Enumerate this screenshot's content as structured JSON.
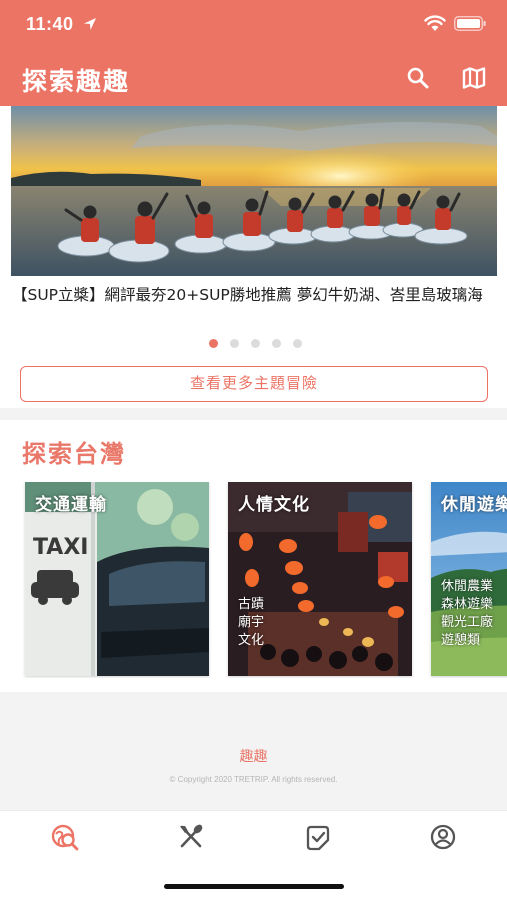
{
  "status_bar": {
    "time": "11:40"
  },
  "header": {
    "title": "探索趣趣",
    "search_icon": "search-icon",
    "map_icon": "map-icon"
  },
  "banner": {
    "caption": "【SUP立槳】網評最夯20+SUP勝地推薦 夢幻牛奶湖、峇里島玻璃海",
    "page_count": 5,
    "active_page": 1
  },
  "more_button": {
    "label": "查看更多主題冒險"
  },
  "explore": {
    "title": "探索台灣",
    "cards": [
      {
        "title": "交通運輸",
        "tags": []
      },
      {
        "title": "人情文化",
        "tags": [
          "古蹟",
          "廟宇",
          "文化"
        ]
      },
      {
        "title": "休閒遊樂",
        "tags": [
          "休閒農業",
          "森林遊樂",
          "觀光工廠",
          "遊憩類"
        ]
      }
    ]
  },
  "footer": {
    "brand": "趣趣",
    "copyright": "© Copyright 2020 TRETRIP. All rights reserved."
  },
  "tabbar": {
    "tabs": [
      {
        "icon": "explore-icon",
        "active": true
      },
      {
        "icon": "food-icon",
        "active": false
      },
      {
        "icon": "checklist-icon",
        "active": false
      },
      {
        "icon": "profile-icon",
        "active": false
      }
    ]
  },
  "colors": {
    "accent": "#ec7465",
    "section_title": "#e9786a",
    "tab_inactive": "#555555"
  }
}
